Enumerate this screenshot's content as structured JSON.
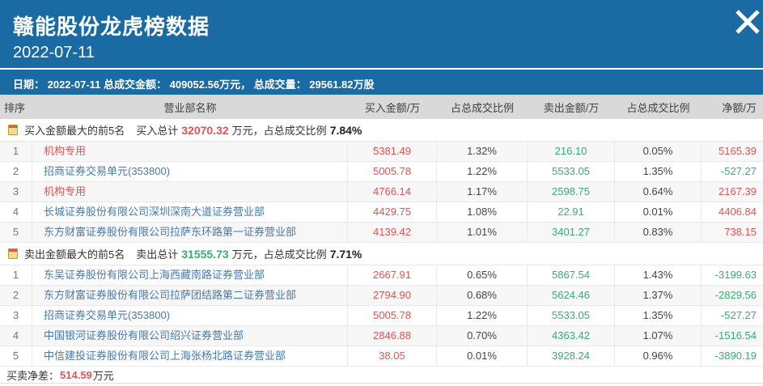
{
  "colors": {
    "header_blue": "#1a6ba4",
    "thead_bg": "#d9d9d9",
    "row_stripe": "#f7f7f7",
    "dark_text": "#404040",
    "link_blue": "#4679ad",
    "buy_red": "#e25353",
    "sell_green": "#3aad73"
  },
  "icons": {
    "close": "x-cross",
    "section_marker": "yellow-note"
  },
  "header": {
    "title": "赣能股份龙虎榜数据",
    "subtitle_date": "2022-07-11",
    "summary": "日期： 2022-07-11 总成交金额： 409052.56万元， 总成交量： 29561.82万股"
  },
  "table": {
    "columns": [
      "排序",
      "营业部名称",
      "买入金额/万",
      "占总成交比例",
      "卖出金额/万",
      "占总成交比例",
      "净额/万"
    ]
  },
  "sections": [
    {
      "id": "buy",
      "title": "买入金额最大的前5名",
      "total_label": "买入总计",
      "total_value": "32070.32",
      "total_unit": "万元，",
      "ratio_label": "占总成交比例",
      "ratio_value": "7.84%",
      "rows": [
        {
          "rank": "1",
          "name": "机构专用",
          "special": true,
          "buy": "5381.49",
          "buy_pct": "1.32%",
          "sell": "216.10",
          "sell_pct": "0.05%",
          "net": "5165.39"
        },
        {
          "rank": "2",
          "name": "招商证券交易单元(353800)",
          "special": false,
          "buy": "5005.78",
          "buy_pct": "1.22%",
          "sell": "5533.05",
          "sell_pct": "1.35%",
          "net": "-527.27"
        },
        {
          "rank": "3",
          "name": "机构专用",
          "special": true,
          "buy": "4766.14",
          "buy_pct": "1.17%",
          "sell": "2598.75",
          "sell_pct": "0.64%",
          "net": "2167.39"
        },
        {
          "rank": "4",
          "name": "长城证券股份有限公司深圳深南大道证券营业部",
          "special": false,
          "buy": "4429.75",
          "buy_pct": "1.08%",
          "sell": "22.91",
          "sell_pct": "0.01%",
          "net": "4406.84"
        },
        {
          "rank": "5",
          "name": "东方财富证券股份有限公司拉萨东环路第一证券营业部",
          "special": false,
          "buy": "4139.42",
          "buy_pct": "1.01%",
          "sell": "3401.27",
          "sell_pct": "0.83%",
          "net": "738.15"
        }
      ]
    },
    {
      "id": "sell",
      "title": "卖出金额最大的前5名",
      "total_label": "卖出总计",
      "total_value": "31555.73",
      "total_unit": "万元，",
      "ratio_label": "占总成交比例",
      "ratio_value": "7.71%",
      "rows": [
        {
          "rank": "1",
          "name": "东吴证券股份有限公司上海西藏南路证券营业部",
          "special": false,
          "buy": "2667.91",
          "buy_pct": "0.65%",
          "sell": "5867.54",
          "sell_pct": "1.43%",
          "net": "-3199.63"
        },
        {
          "rank": "2",
          "name": "东方财富证券股份有限公司拉萨团结路第二证券营业部",
          "special": false,
          "buy": "2794.90",
          "buy_pct": "0.68%",
          "sell": "5624.46",
          "sell_pct": "1.37%",
          "net": "-2829.56"
        },
        {
          "rank": "3",
          "name": "招商证券交易单元(353800)",
          "special": false,
          "buy": "5005.78",
          "buy_pct": "1.22%",
          "sell": "5533.05",
          "sell_pct": "1.35%",
          "net": "-527.27"
        },
        {
          "rank": "4",
          "name": "中国银河证券股份有限公司绍兴证券营业部",
          "special": false,
          "buy": "2846.88",
          "buy_pct": "0.70%",
          "sell": "4363.42",
          "sell_pct": "1.07%",
          "net": "-1516.54"
        },
        {
          "rank": "5",
          "name": "中信建投证券股份有限公司上海张杨北路证券营业部",
          "special": false,
          "buy": "38.05",
          "buy_pct": "0.01%",
          "sell": "3928.24",
          "sell_pct": "0.96%",
          "net": "-3890.19"
        }
      ]
    }
  ],
  "footer": {
    "label": "买卖净差：",
    "value": "514.59",
    "unit": "万元"
  }
}
